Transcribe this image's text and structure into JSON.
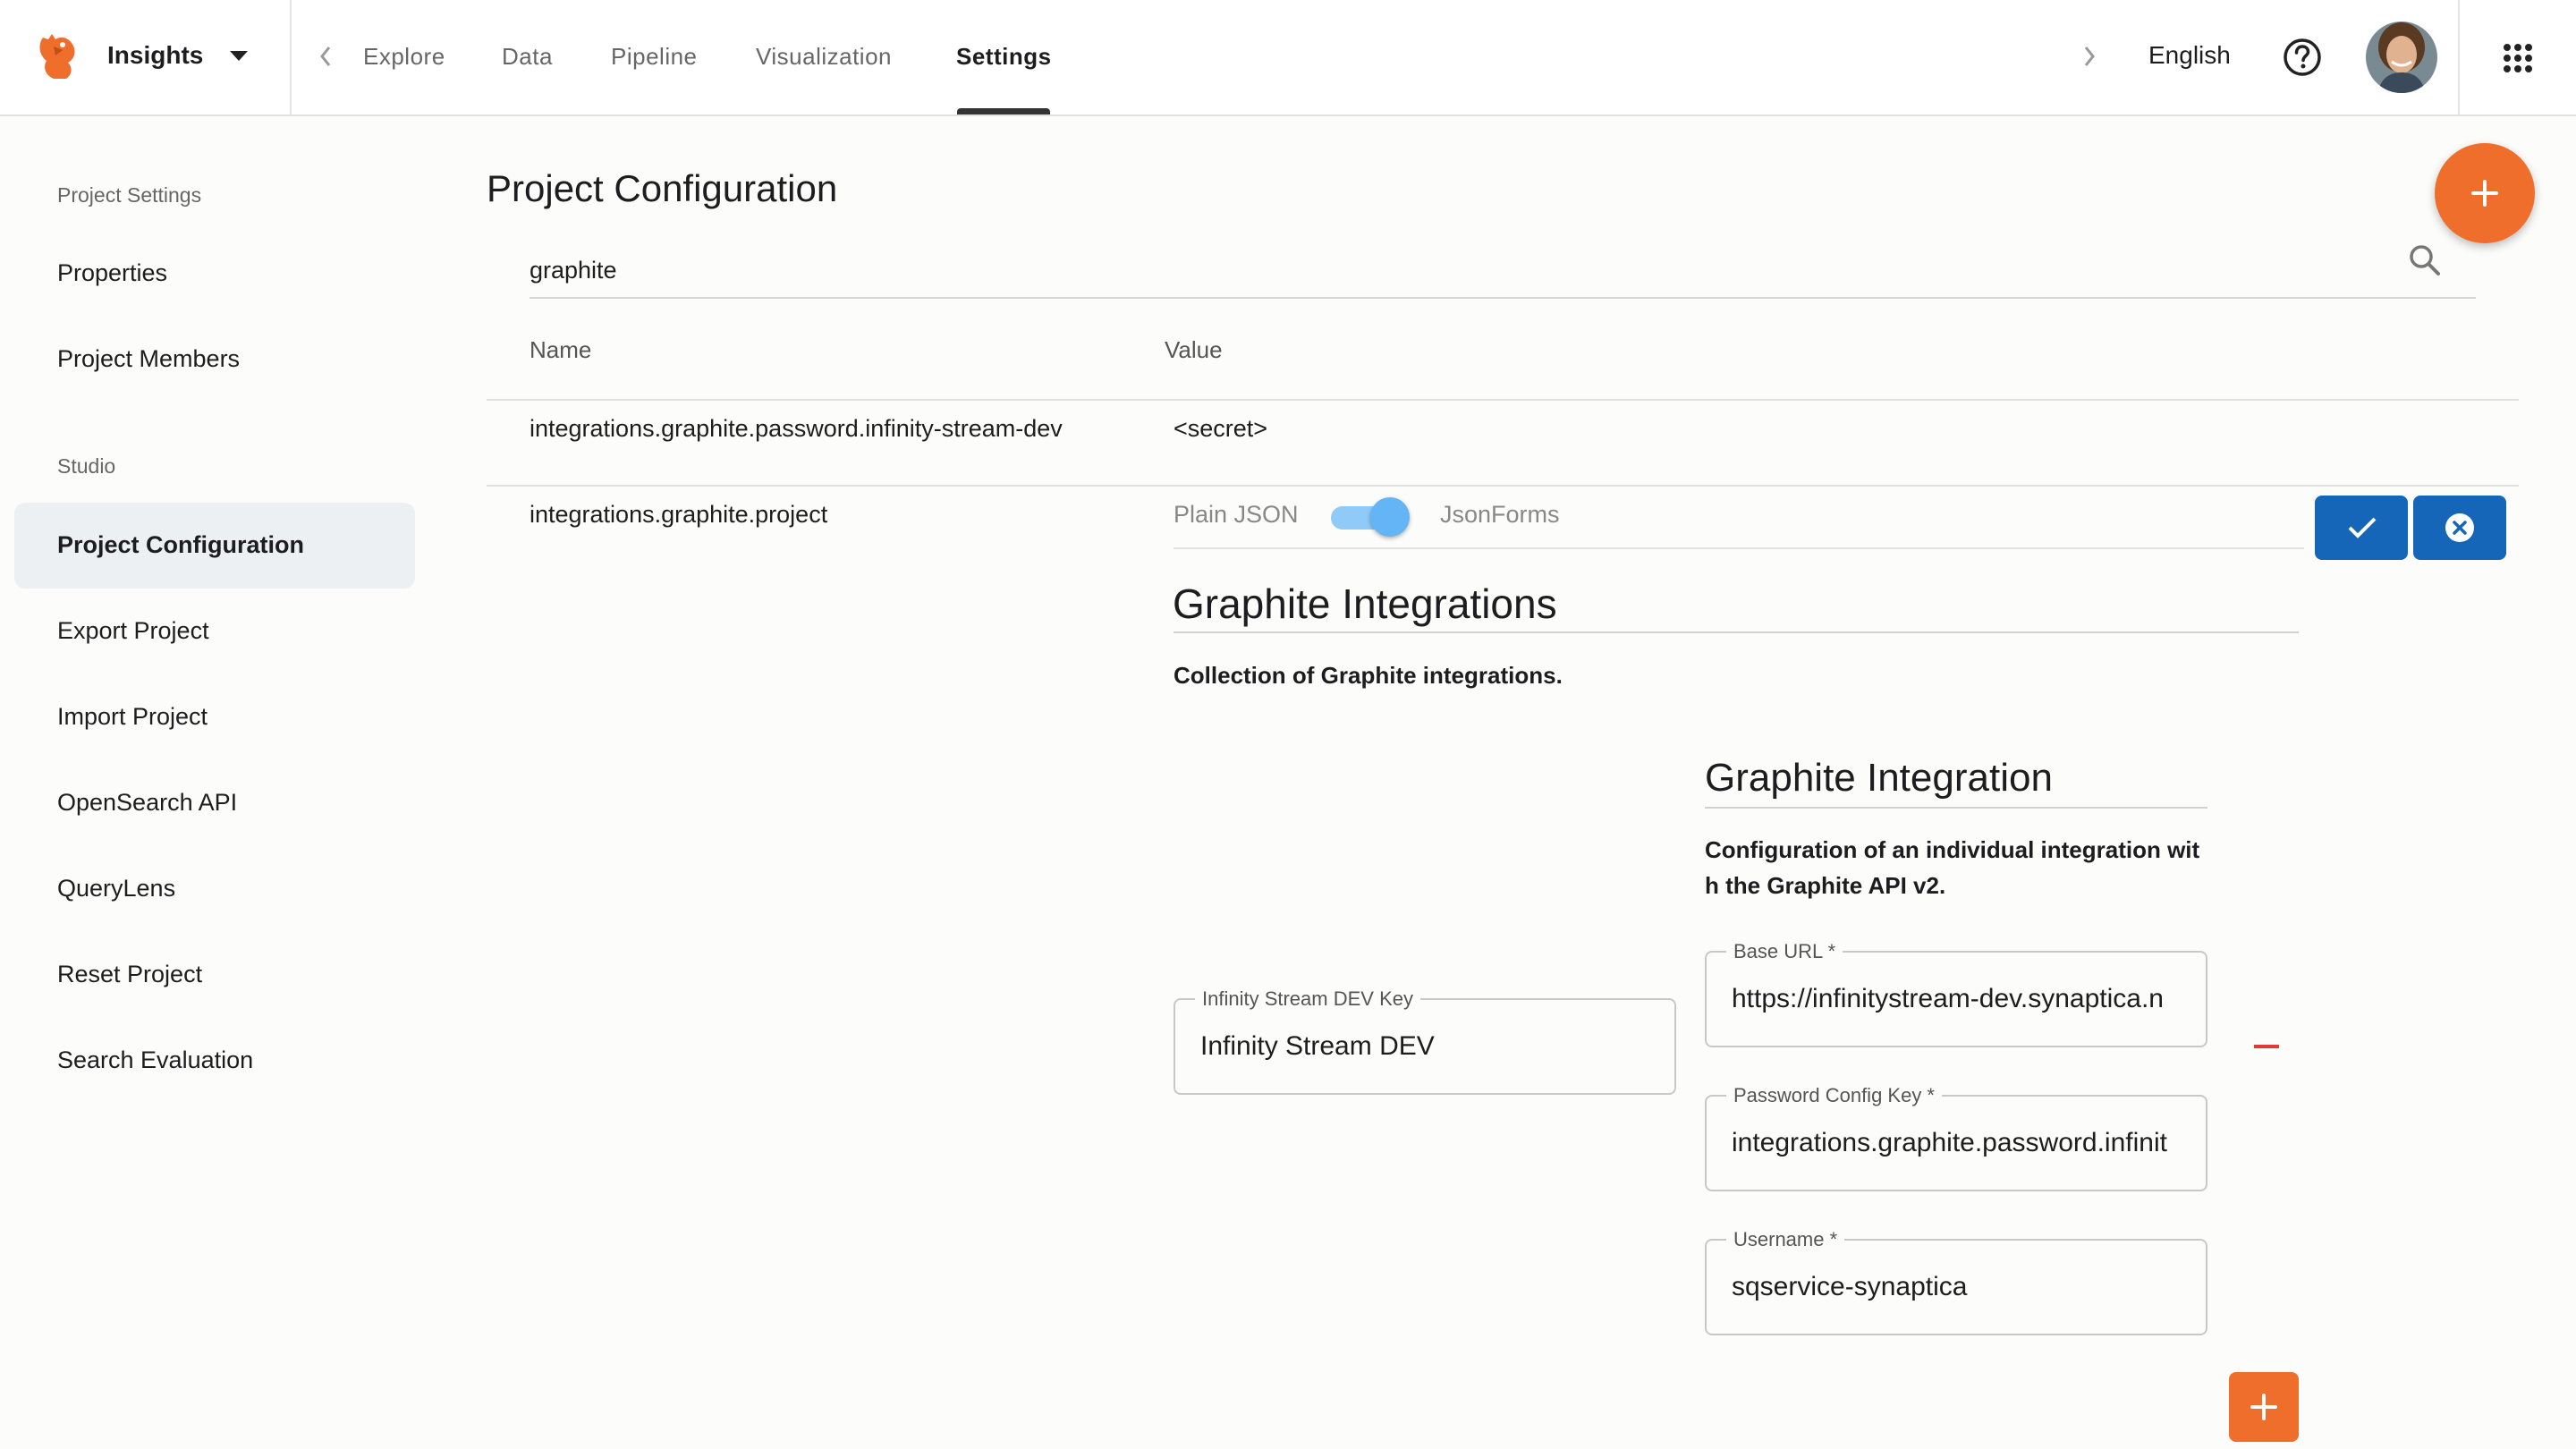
{
  "header": {
    "app_name": "Insights",
    "nav_tabs": [
      "Explore",
      "Data",
      "Pipeline",
      "Visualization",
      "Settings"
    ],
    "active_tab": "Settings",
    "language": "English"
  },
  "sidebar": {
    "section_project": "Project Settings",
    "project_items": [
      "Properties",
      "Project Members"
    ],
    "section_studio": "Studio",
    "studio_items": [
      "Project Configuration",
      "Export Project",
      "Import Project",
      "OpenSearch API",
      "QueryLens",
      "Reset Project",
      "Search Evaluation"
    ],
    "active_item": "Project Configuration"
  },
  "main": {
    "title": "Project Configuration",
    "search_value": "graphite",
    "columns": {
      "name": "Name",
      "value": "Value"
    },
    "rows": [
      {
        "name": "integrations.graphite.password.infinity-stream-dev",
        "value": "<secret>"
      },
      {
        "name": "integrations.graphite.project"
      }
    ],
    "editor": {
      "toggle_left": "Plain JSON",
      "toggle_right": "JsonForms",
      "toggle_on": true,
      "section_title": "Graphite Integrations",
      "section_desc": "Collection of Graphite integrations.",
      "key_field": {
        "label": "Infinity Stream DEV Key",
        "value": "Infinity Stream DEV"
      },
      "item_title": "Graphite Integration",
      "item_desc_line1": "Configuration of an individual integration wit",
      "item_desc_line2": "h the Graphite API v2.",
      "fields": [
        {
          "label": "Base URL *",
          "value": "https://infinitystream-dev.synaptica.n"
        },
        {
          "label": "Password Config Key *",
          "value": "integrations.graphite.password.infinit"
        },
        {
          "label": "Username *",
          "value": "sqservice-synaptica"
        }
      ]
    }
  },
  "colors": {
    "accent": "#ef6e2b",
    "primary": "#1565b8",
    "toggle": "#90caf9"
  }
}
